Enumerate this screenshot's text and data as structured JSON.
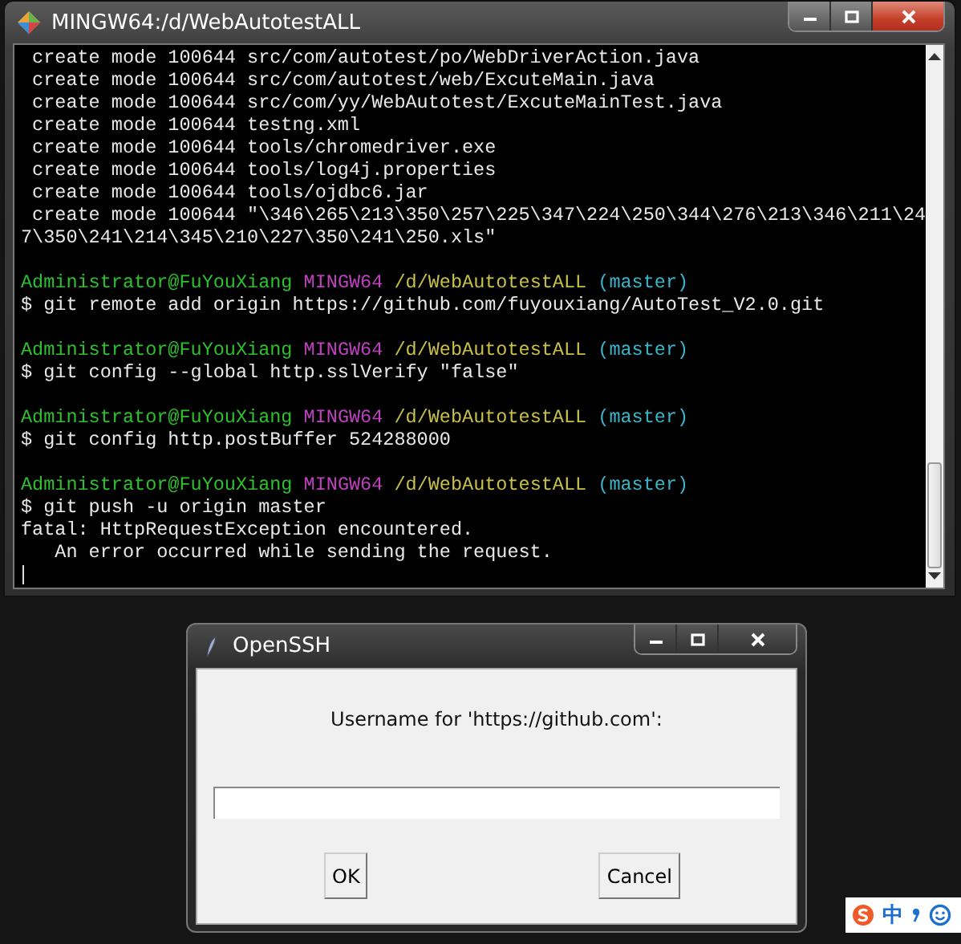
{
  "terminal": {
    "title": "MINGW64:/d/WebAutotestALL",
    "lines": [
      {
        "kind": "output",
        "text": " create mode 100644 src/com/autotest/po/WebDriverAction.java"
      },
      {
        "kind": "output",
        "text": " create mode 100644 src/com/autotest/web/ExcuteMain.java"
      },
      {
        "kind": "output",
        "text": " create mode 100644 src/com/yy/WebAutotest/ExcuteMainTest.java"
      },
      {
        "kind": "output",
        "text": " create mode 100644 testng.xml"
      },
      {
        "kind": "output",
        "text": " create mode 100644 tools/chromedriver.exe"
      },
      {
        "kind": "output",
        "text": " create mode 100644 tools/log4j.properties"
      },
      {
        "kind": "output",
        "text": " create mode 100644 tools/ojdbc6.jar"
      },
      {
        "kind": "output",
        "text": " create mode 100644 \"\\346\\265\\213\\350\\257\\225\\347\\224\\250\\344\\276\\213\\346\\211\\24"
      },
      {
        "kind": "output",
        "text": "7\\350\\241\\214\\345\\210\\227\\350\\241\\250.xls\""
      },
      {
        "kind": "blank"
      },
      {
        "kind": "prompt",
        "user": "Administrator@FuYouXiang",
        "host": "MINGW64",
        "path": "/d/WebAutotestALL",
        "branch": "(master)"
      },
      {
        "kind": "command",
        "text": "$ git remote add origin https://github.com/fuyouxiang/AutoTest_V2.0.git"
      },
      {
        "kind": "blank"
      },
      {
        "kind": "prompt",
        "user": "Administrator@FuYouXiang",
        "host": "MINGW64",
        "path": "/d/WebAutotestALL",
        "branch": "(master)"
      },
      {
        "kind": "command",
        "text": "$ git config --global http.sslVerify \"false\""
      },
      {
        "kind": "blank"
      },
      {
        "kind": "prompt",
        "user": "Administrator@FuYouXiang",
        "host": "MINGW64",
        "path": "/d/WebAutotestALL",
        "branch": "(master)"
      },
      {
        "kind": "command",
        "text": "$ git config http.postBuffer 524288000"
      },
      {
        "kind": "blank"
      },
      {
        "kind": "prompt",
        "user": "Administrator@FuYouXiang",
        "host": "MINGW64",
        "path": "/d/WebAutotestALL",
        "branch": "(master)"
      },
      {
        "kind": "command",
        "text": "$ git push -u origin master"
      },
      {
        "kind": "output",
        "text": "fatal: HttpRequestException encountered."
      },
      {
        "kind": "output",
        "text": "   An error occurred while sending the request."
      },
      {
        "kind": "cursor"
      }
    ]
  },
  "dialog": {
    "title": "OpenSSH",
    "prompt": "Username for 'https://github.com':",
    "buttons": [
      "OK",
      "Cancel"
    ]
  },
  "ime_toolbar": {
    "label": "中"
  }
}
